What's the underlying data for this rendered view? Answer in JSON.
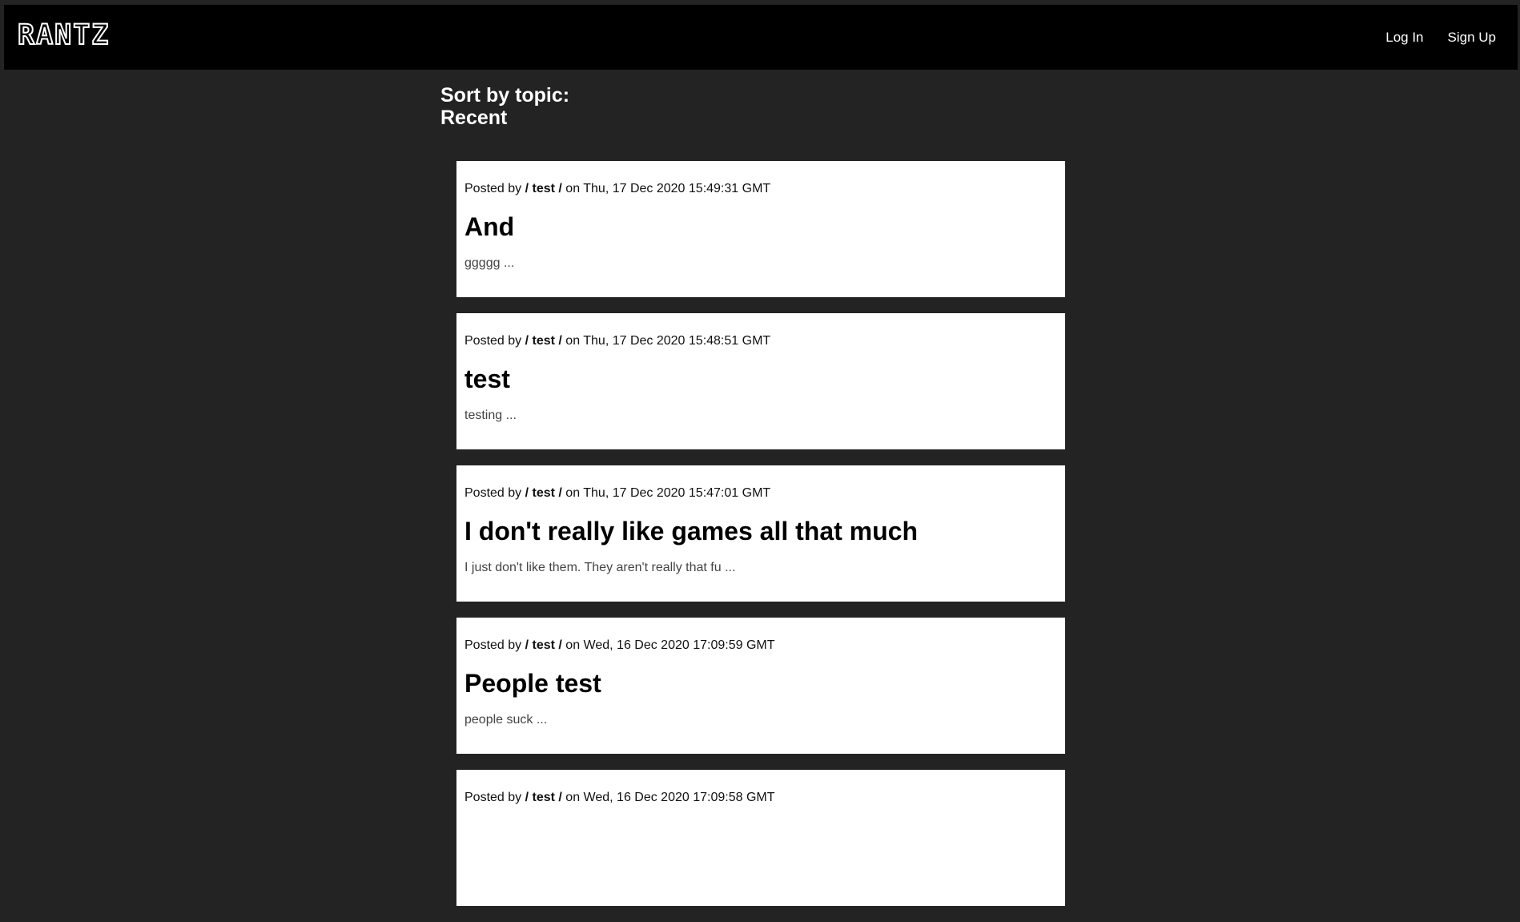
{
  "header": {
    "logo": "RANTZ",
    "nav": [
      {
        "label": "Log In"
      },
      {
        "label": "Sign Up"
      }
    ]
  },
  "sort": {
    "label": "Sort by topic:",
    "value": "Recent"
  },
  "posts": [
    {
      "posted_by": "Posted by",
      "author": "/ test /",
      "date": "on Thu, 17 Dec 2020 15:49:31 GMT",
      "title": "And",
      "excerpt": "ggggg ..."
    },
    {
      "posted_by": "Posted by",
      "author": "/ test /",
      "date": "on Thu, 17 Dec 2020 15:48:51 GMT",
      "title": "test",
      "excerpt": "testing ..."
    },
    {
      "posted_by": "Posted by",
      "author": "/ test /",
      "date": "on Thu, 17 Dec 2020 15:47:01 GMT",
      "title": "I don't really like games all that much",
      "excerpt": "I just don't like them. They aren't really that fu ..."
    },
    {
      "posted_by": "Posted by",
      "author": "/ test /",
      "date": "on Wed, 16 Dec 2020 17:09:59 GMT",
      "title": "People test",
      "excerpt": "people suck ..."
    },
    {
      "posted_by": "Posted by",
      "author": "/ test /",
      "date": "on Wed, 16 Dec 2020 17:09:58 GMT",
      "title": "",
      "excerpt": ""
    }
  ]
}
